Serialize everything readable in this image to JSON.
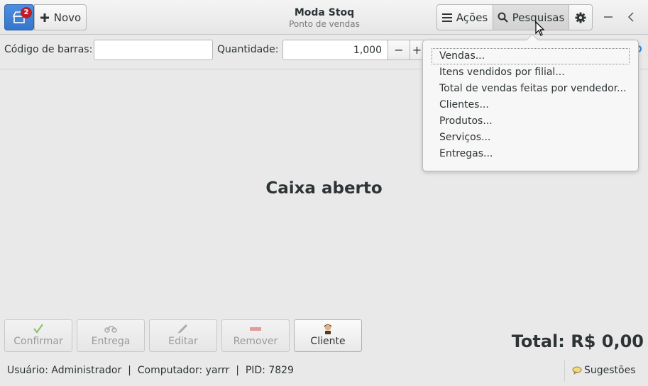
{
  "header": {
    "home_badge": "2",
    "new_label": "Novo",
    "title": "Moda Stoq",
    "subtitle": "Ponto de vendas",
    "actions_label": "Ações",
    "searches_label": "Pesquisas"
  },
  "toolbar": {
    "barcode_label": "Código de barras:",
    "barcode_value": "",
    "quantity_label": "Quantidade:",
    "quantity_value": "1,000",
    "minus": "−",
    "plus": "+"
  },
  "main": {
    "status_text": "Caixa aberto"
  },
  "actions": {
    "confirm": "Confirmar",
    "delivery": "Entrega",
    "edit": "Editar",
    "remove": "Remover",
    "client": "Cliente"
  },
  "total": "Total: R$ 0,00",
  "statusbar": {
    "info": "Usuário: Administrador  |  Computador: yarrr  |  PID: 7829",
    "suggestions": "Sugestões"
  },
  "search_menu": {
    "items": [
      {
        "label": "Vendas..."
      },
      {
        "label": "Itens vendidos por filial..."
      },
      {
        "label": "Total de vendas feitas por vendedor..."
      },
      {
        "label": "Clientes..."
      },
      {
        "label": "Produtos..."
      },
      {
        "label": "Serviços..."
      },
      {
        "label": "Entregas..."
      }
    ]
  },
  "colors": {
    "accent": "#3576cb",
    "badge": "#c01c28"
  }
}
